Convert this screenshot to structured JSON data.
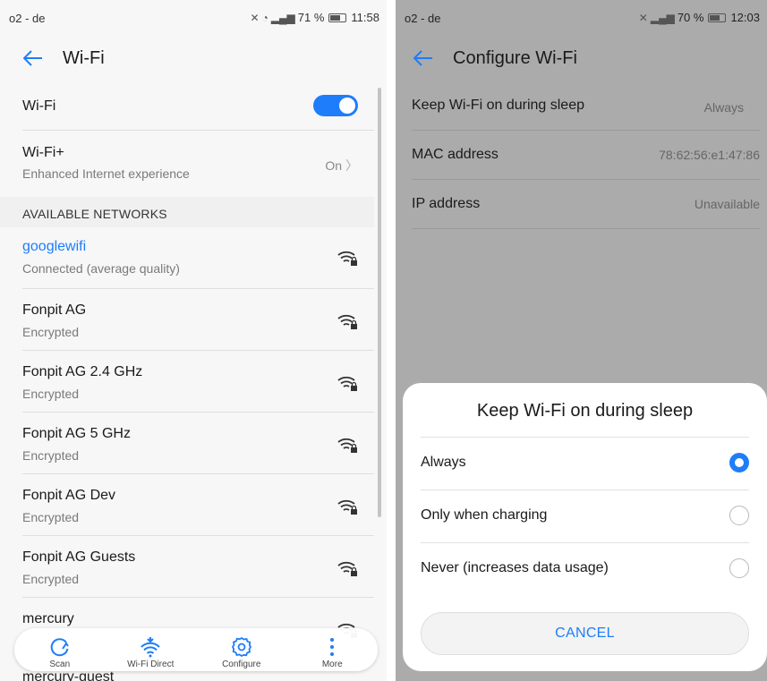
{
  "left": {
    "status": {
      "carrier": "o2 - de",
      "signal": "71 %",
      "time": "11:58"
    },
    "title": "Wi-Fi",
    "wifi_row": {
      "label": "Wi-Fi",
      "enabled": true
    },
    "wifiplus_row": {
      "label": "Wi-Fi+",
      "sub": "Enhanced Internet experience",
      "value": "On"
    },
    "section": "AVAILABLE NETWORKS",
    "networks": [
      {
        "name": "googlewifi",
        "status": "Connected (average quality)"
      },
      {
        "name": "Fonpit AG",
        "status": "Encrypted"
      },
      {
        "name": "Fonpit AG 2.4 GHz",
        "status": "Encrypted"
      },
      {
        "name": "Fonpit AG 5 GHz",
        "status": "Encrypted"
      },
      {
        "name": "Fonpit AG Dev",
        "status": "Encrypted"
      },
      {
        "name": "Fonpit AG Guests",
        "status": "Encrypted"
      },
      {
        "name": "mercury",
        "status": ""
      }
    ],
    "peek": "mercury-guest",
    "bottom": {
      "scan": "Scan",
      "wifi_direct": "Wi-Fi Direct",
      "configure": "Configure",
      "more": "More"
    },
    "accent": "#1e7dfa"
  },
  "right": {
    "status": {
      "carrier": "o2 - de",
      "signal": "70 %",
      "time": "12:03"
    },
    "title": "Configure Wi-Fi",
    "rows": [
      {
        "label": "Keep Wi-Fi on during sleep",
        "value": "Always"
      },
      {
        "label": "MAC address",
        "value": "78:62:56:e1:47:86"
      },
      {
        "label": "IP address",
        "value": "Unavailable"
      }
    ],
    "dialog": {
      "title": "Keep Wi-Fi on during sleep",
      "options": [
        "Always",
        "Only when charging",
        "Never (increases data usage)"
      ],
      "selected": "Always",
      "cancel": "CANCEL"
    }
  }
}
